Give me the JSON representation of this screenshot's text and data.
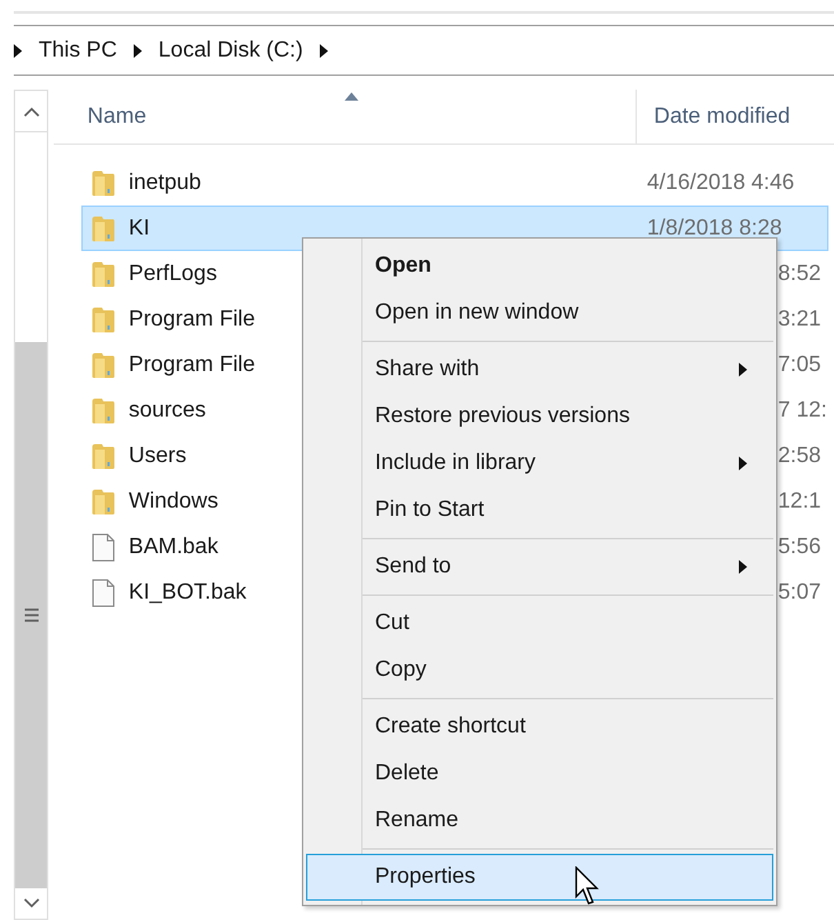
{
  "breadcrumb": [
    "This PC",
    "Local Disk (C:)"
  ],
  "columns": [
    {
      "label": "Name",
      "sorted": true
    },
    {
      "label": "Date modified",
      "sorted": false
    }
  ],
  "rows": [
    {
      "kind": "folder",
      "name": "inetpub",
      "date": "4/16/2018 4:46",
      "selected": false
    },
    {
      "kind": "folder",
      "name": "KI",
      "date": "1/8/2018 8:28",
      "selected": true
    },
    {
      "kind": "folder",
      "name": "PerfLogs",
      "date": "8:52",
      "selected": false
    },
    {
      "kind": "folder",
      "name": "Program File",
      "date": "3:21",
      "selected": false
    },
    {
      "kind": "folder",
      "name": "Program File",
      "date": "7:05",
      "selected": false
    },
    {
      "kind": "folder",
      "name": "sources",
      "date": "7 12:",
      "selected": false
    },
    {
      "kind": "folder",
      "name": "Users",
      "date": "2:58",
      "selected": false
    },
    {
      "kind": "folder",
      "name": "Windows",
      "date": "12:1",
      "selected": false
    },
    {
      "kind": "file",
      "name": "BAM.bak",
      "date": "5:56",
      "selected": false
    },
    {
      "kind": "file",
      "name": "KI_BOT.bak",
      "date": "5:07",
      "selected": false
    }
  ],
  "context_menu": {
    "groups": [
      [
        {
          "label": "Open",
          "bold": true,
          "submenu": false,
          "selected": false
        },
        {
          "label": "Open in new window",
          "bold": false,
          "submenu": false,
          "selected": false
        }
      ],
      [
        {
          "label": "Share with",
          "bold": false,
          "submenu": true,
          "selected": false
        },
        {
          "label": "Restore previous versions",
          "bold": false,
          "submenu": false,
          "selected": false
        },
        {
          "label": "Include in library",
          "bold": false,
          "submenu": true,
          "selected": false
        },
        {
          "label": "Pin to Start",
          "bold": false,
          "submenu": false,
          "selected": false
        }
      ],
      [
        {
          "label": "Send to",
          "bold": false,
          "submenu": true,
          "selected": false
        }
      ],
      [
        {
          "label": "Cut",
          "bold": false,
          "submenu": false,
          "selected": false
        },
        {
          "label": "Copy",
          "bold": false,
          "submenu": false,
          "selected": false
        }
      ],
      [
        {
          "label": "Create shortcut",
          "bold": false,
          "submenu": false,
          "selected": false
        },
        {
          "label": "Delete",
          "bold": false,
          "submenu": false,
          "selected": false
        },
        {
          "label": "Rename",
          "bold": false,
          "submenu": false,
          "selected": false
        }
      ],
      [
        {
          "label": "Properties",
          "bold": false,
          "submenu": false,
          "selected": true
        }
      ]
    ]
  }
}
